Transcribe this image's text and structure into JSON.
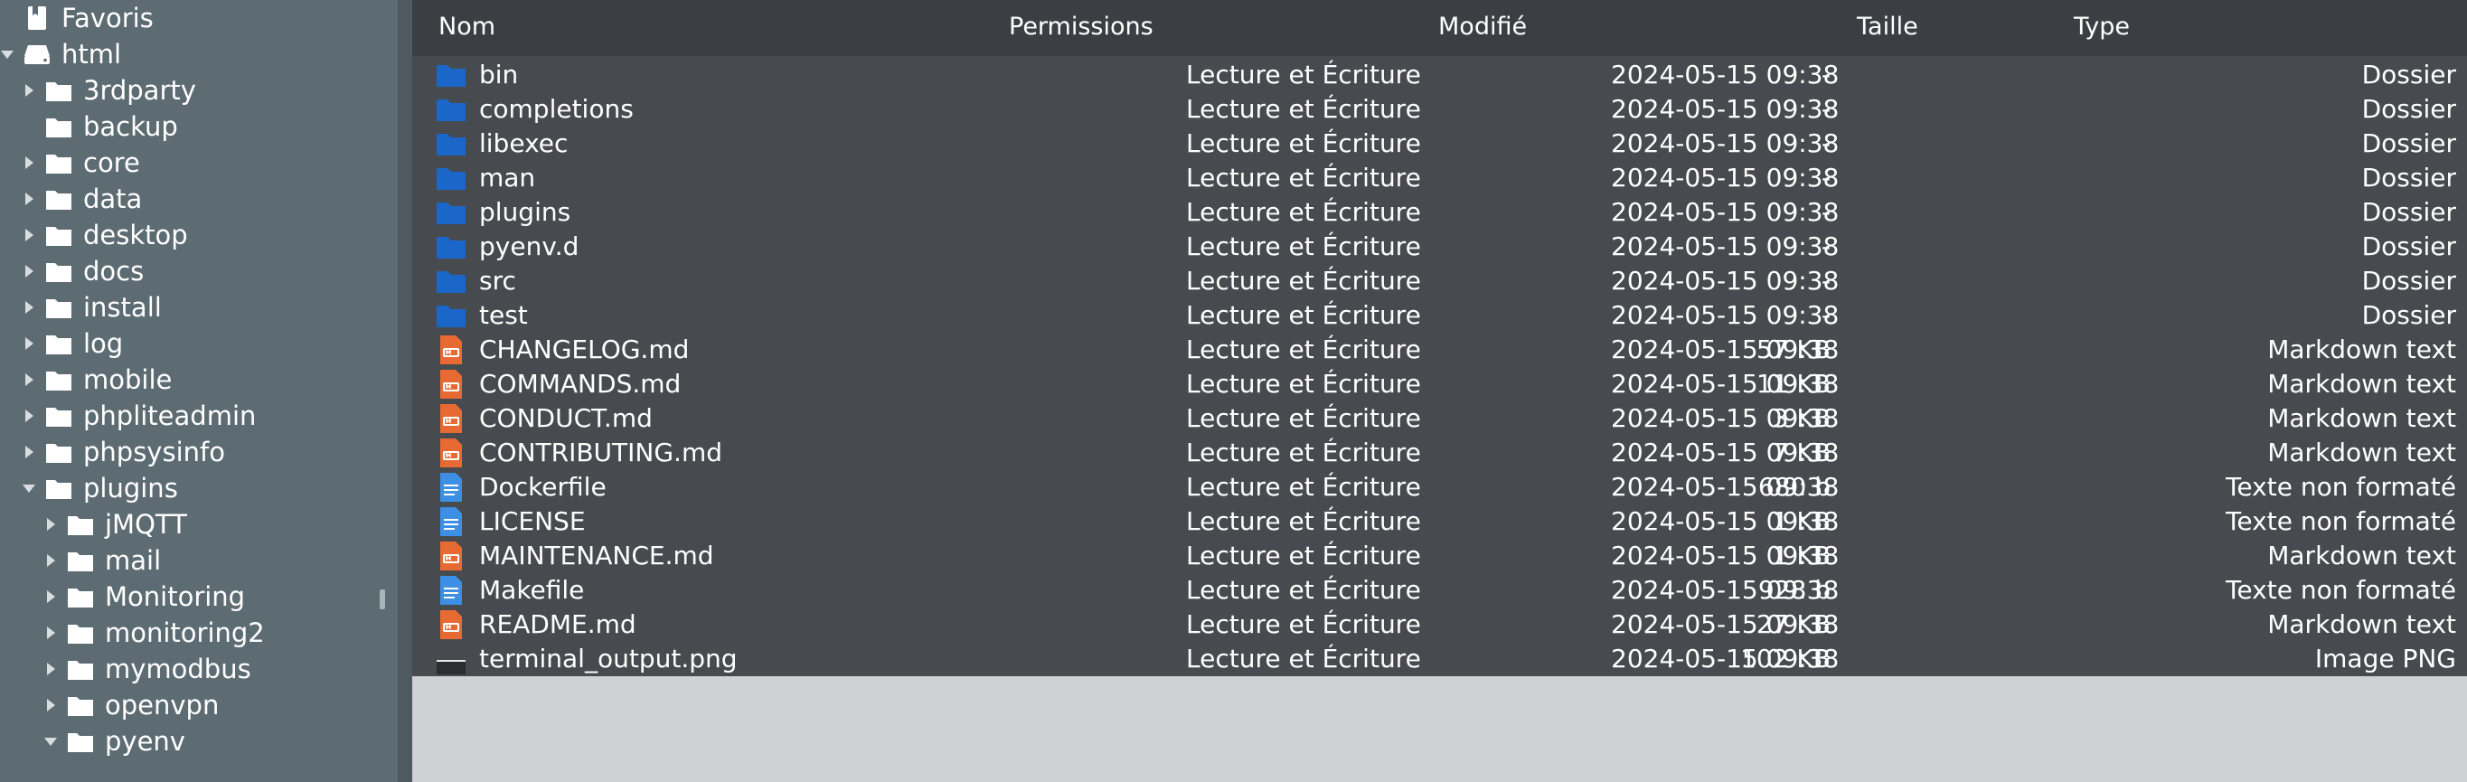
{
  "sidebar": {
    "items": [
      {
        "label": "Favoris",
        "icon": "bookmark-icon",
        "caret": "none",
        "indent": 0
      },
      {
        "label": "html",
        "icon": "drive-icon",
        "caret": "down",
        "indent": 0
      },
      {
        "label": "3rdparty",
        "icon": "folder-icon",
        "caret": "right",
        "indent": 1
      },
      {
        "label": "backup",
        "icon": "folder-icon",
        "caret": "none",
        "indent": 1
      },
      {
        "label": "core",
        "icon": "folder-icon",
        "caret": "right",
        "indent": 1
      },
      {
        "label": "data",
        "icon": "folder-icon",
        "caret": "right",
        "indent": 1
      },
      {
        "label": "desktop",
        "icon": "folder-icon",
        "caret": "right",
        "indent": 1
      },
      {
        "label": "docs",
        "icon": "folder-icon",
        "caret": "right",
        "indent": 1
      },
      {
        "label": "install",
        "icon": "folder-icon",
        "caret": "right",
        "indent": 1
      },
      {
        "label": "log",
        "icon": "folder-icon",
        "caret": "right",
        "indent": 1
      },
      {
        "label": "mobile",
        "icon": "folder-icon",
        "caret": "right",
        "indent": 1
      },
      {
        "label": "phpliteadmin",
        "icon": "folder-icon",
        "caret": "right",
        "indent": 1
      },
      {
        "label": "phpsysinfo",
        "icon": "folder-icon",
        "caret": "right",
        "indent": 1
      },
      {
        "label": "plugins",
        "icon": "folder-icon",
        "caret": "down",
        "indent": 1
      },
      {
        "label": "jMQTT",
        "icon": "folder-icon",
        "caret": "right",
        "indent": 2
      },
      {
        "label": "mail",
        "icon": "folder-icon",
        "caret": "right",
        "indent": 2
      },
      {
        "label": "Monitoring",
        "icon": "folder-icon",
        "caret": "right",
        "indent": 2
      },
      {
        "label": "monitoring2",
        "icon": "folder-icon",
        "caret": "right",
        "indent": 2
      },
      {
        "label": "mymodbus",
        "icon": "folder-icon",
        "caret": "right",
        "indent": 2
      },
      {
        "label": "openvpn",
        "icon": "folder-icon",
        "caret": "right",
        "indent": 2
      },
      {
        "label": "pyenv",
        "icon": "folder-icon",
        "caret": "down",
        "indent": 2
      }
    ]
  },
  "header": {
    "name": "Nom",
    "permissions": "Permissions",
    "modified": "Modifié",
    "size": "Taille",
    "type": "Type"
  },
  "files": [
    {
      "name": "bin",
      "icon": "folder-icon",
      "perm": "Lecture et Écriture",
      "mod": "2024-05-15 09:38",
      "size": "-",
      "type": "Dossier"
    },
    {
      "name": "completions",
      "icon": "folder-icon",
      "perm": "Lecture et Écriture",
      "mod": "2024-05-15 09:38",
      "size": "-",
      "type": "Dossier"
    },
    {
      "name": "libexec",
      "icon": "folder-icon",
      "perm": "Lecture et Écriture",
      "mod": "2024-05-15 09:38",
      "size": "-",
      "type": "Dossier"
    },
    {
      "name": "man",
      "icon": "folder-icon",
      "perm": "Lecture et Écriture",
      "mod": "2024-05-15 09:38",
      "size": "-",
      "type": "Dossier"
    },
    {
      "name": "plugins",
      "icon": "folder-icon",
      "perm": "Lecture et Écriture",
      "mod": "2024-05-15 09:38",
      "size": "-",
      "type": "Dossier"
    },
    {
      "name": "pyenv.d",
      "icon": "folder-icon",
      "perm": "Lecture et Écriture",
      "mod": "2024-05-15 09:38",
      "size": "-",
      "type": "Dossier"
    },
    {
      "name": "src",
      "icon": "folder-icon",
      "perm": "Lecture et Écriture",
      "mod": "2024-05-15 09:38",
      "size": "-",
      "type": "Dossier"
    },
    {
      "name": "test",
      "icon": "folder-icon",
      "perm": "Lecture et Écriture",
      "mod": "2024-05-15 09:38",
      "size": "-",
      "type": "Dossier"
    },
    {
      "name": "CHANGELOG.md",
      "icon": "markdown-file-icon",
      "perm": "Lecture et Écriture",
      "mod": "2024-05-15 09:38",
      "size": "57 KB",
      "type": "Markdown text"
    },
    {
      "name": "COMMANDS.md",
      "icon": "markdown-file-icon",
      "perm": "Lecture et Écriture",
      "mod": "2024-05-15 09:38",
      "size": "11 KB",
      "type": "Markdown text"
    },
    {
      "name": "CONDUCT.md",
      "icon": "markdown-file-icon",
      "perm": "Lecture et Écriture",
      "mod": "2024-05-15 09:38",
      "size": "3 KB",
      "type": "Markdown text"
    },
    {
      "name": "CONTRIBUTING.md",
      "icon": "markdown-file-icon",
      "perm": "Lecture et Écriture",
      "mod": "2024-05-15 09:38",
      "size": "7 KB",
      "type": "Markdown text"
    },
    {
      "name": "Dockerfile",
      "icon": "text-file-icon",
      "perm": "Lecture et Écriture",
      "mod": "2024-05-15 09:38",
      "size": "680 b",
      "type": "Texte non formaté"
    },
    {
      "name": "LICENSE",
      "icon": "text-file-icon",
      "perm": "Lecture et Écriture",
      "mod": "2024-05-15 09:38",
      "size": "1 KB",
      "type": "Texte non formaté"
    },
    {
      "name": "MAINTENANCE.md",
      "icon": "markdown-file-icon",
      "perm": "Lecture et Écriture",
      "mod": "2024-05-15 09:38",
      "size": "1 KB",
      "type": "Markdown text"
    },
    {
      "name": "Makefile",
      "icon": "text-file-icon",
      "perm": "Lecture et Écriture",
      "mod": "2024-05-15 09:38",
      "size": "928 b",
      "type": "Texte non formaté"
    },
    {
      "name": "README.md",
      "icon": "markdown-file-icon",
      "perm": "Lecture et Écriture",
      "mod": "2024-05-15 09:38",
      "size": "27 KB",
      "type": "Markdown text"
    },
    {
      "name": "terminal_output.png",
      "icon": "image-file-icon",
      "perm": "Lecture et Écriture",
      "mod": "2024-05-15 09:38",
      "size": "102 KB",
      "type": "Image PNG"
    }
  ],
  "colors": {
    "folder": "#1a67c9",
    "markdown": "#e86a33",
    "text_file": "#3d8fe6",
    "sidebar_bg": "#5d6b73",
    "list_bg": "#474a4e",
    "header_bg": "#3b3f44"
  }
}
